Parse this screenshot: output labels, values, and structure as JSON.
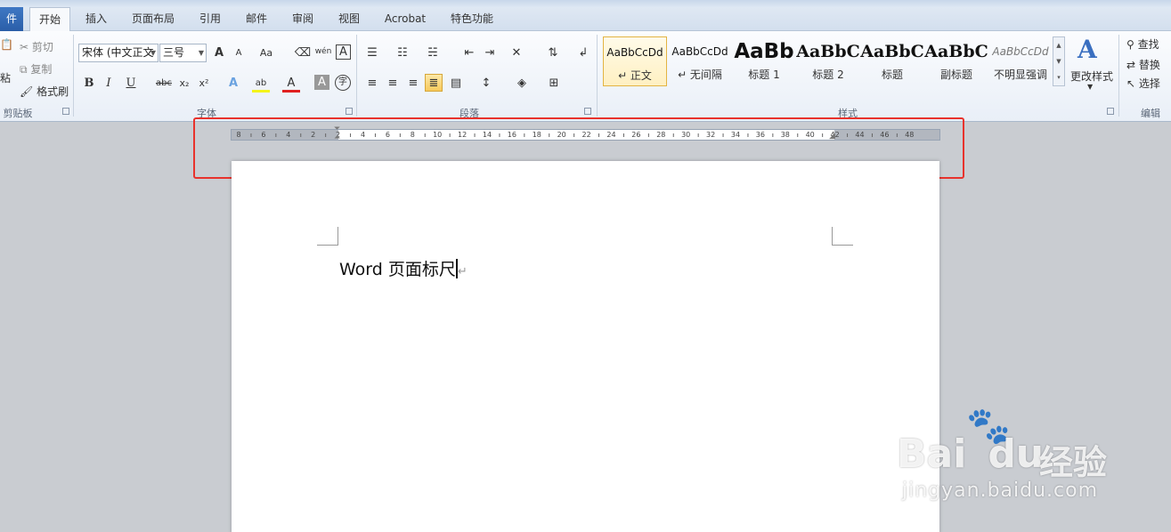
{
  "tabs": {
    "file": "件",
    "items": [
      "开始",
      "插入",
      "页面布局",
      "引用",
      "邮件",
      "审阅",
      "视图",
      "Acrobat",
      "特色功能"
    ],
    "active_index": 0
  },
  "clipboard": {
    "paste": "粘",
    "cut": "剪切",
    "copy": "复制",
    "format_painter": "格式刷",
    "group_label": "剪贴板"
  },
  "font": {
    "font_name": "宋体 (中文正文",
    "font_size": "三号",
    "group_label": "字体",
    "grow": "A",
    "shrink": "A",
    "change_case": "Aa",
    "bold": "B",
    "italic": "I",
    "underline": "U",
    "strike": "abc",
    "subscript": "x₂",
    "superscript": "x²",
    "color_a": "A",
    "char_shading": "A",
    "enclose": "字",
    "phonetic": "wén",
    "border": "A"
  },
  "paragraph": {
    "group_label": "段落"
  },
  "styles": {
    "group_label": "样式",
    "items": [
      {
        "sample": "AaBbCcDd",
        "name": "↵ 正文"
      },
      {
        "sample": "AaBbCcDd",
        "name": "↵ 无间隔"
      },
      {
        "sample": "AaBb",
        "name": "标题 1"
      },
      {
        "sample": "AaBbC",
        "name": "标题 2"
      },
      {
        "sample": "AaBbC",
        "name": "标题"
      },
      {
        "sample": "AaBbC",
        "name": "副标题"
      },
      {
        "sample": "AaBbCcDd",
        "name": "不明显强调"
      }
    ],
    "change_styles": "更改样式"
  },
  "editing": {
    "find": "查找",
    "replace": "替换",
    "select": "选择",
    "group_label": "编辑"
  },
  "ruler": {
    "labels": [
      "8",
      "6",
      "4",
      "2",
      "2",
      "4",
      "6",
      "8",
      "10",
      "12",
      "14",
      "16",
      "18",
      "20",
      "22",
      "24",
      "26",
      "28",
      "30",
      "32",
      "34",
      "36",
      "38",
      "40",
      "42",
      "44",
      "46",
      "48"
    ]
  },
  "document": {
    "text": "Word 页面标尺",
    "para_mark": "↵"
  },
  "watermark": {
    "brand": "Bai",
    "brand2": "du",
    "cn": "经验",
    "url": "jingyan.baidu.com"
  }
}
